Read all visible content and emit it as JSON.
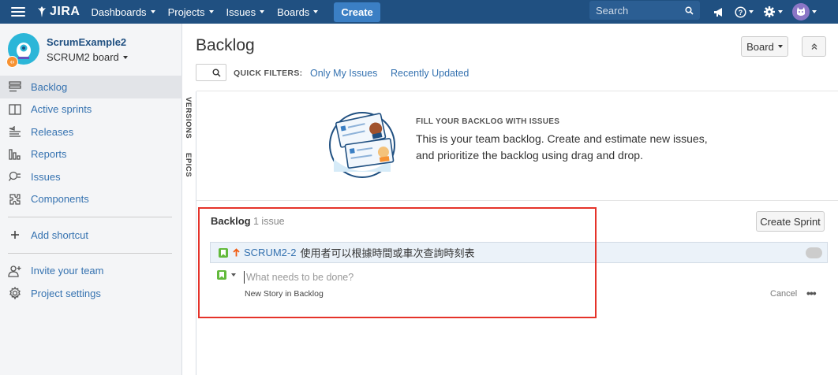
{
  "topnav": {
    "logo_text": "JIRA",
    "menus": [
      "Dashboards",
      "Projects",
      "Issues",
      "Boards"
    ],
    "create_label": "Create",
    "search_placeholder": "Search",
    "bg_color": "#205081"
  },
  "sidebar": {
    "project_name": "ScrumExample2",
    "board_name": "SCRUM2 board",
    "items": [
      {
        "label": "Backlog",
        "icon": "backlog-icon"
      },
      {
        "label": "Active sprints",
        "icon": "active-sprints-icon"
      },
      {
        "label": "Releases",
        "icon": "releases-icon"
      },
      {
        "label": "Reports",
        "icon": "reports-icon"
      },
      {
        "label": "Issues",
        "icon": "issues-icon"
      },
      {
        "label": "Components",
        "icon": "components-icon"
      }
    ],
    "add_shortcut": "Add shortcut",
    "invite_team": "Invite your team",
    "project_settings": "Project settings"
  },
  "strip": {
    "versions": "VERSIONS",
    "epics": "EPICS"
  },
  "header": {
    "title": "Backlog",
    "board_button": "Board",
    "quick_filters_label": "QUICK FILTERS:",
    "filters": [
      "Only My Issues",
      "Recently Updated"
    ]
  },
  "empty_state": {
    "heading": "FILL YOUR BACKLOG WITH ISSUES",
    "body": "This is your team backlog. Create and estimate new issues, and prioritize the backlog using drag and drop."
  },
  "backlog": {
    "title": "Backlog",
    "count": "1 issue",
    "create_sprint": "Create Sprint",
    "issues": [
      {
        "key": "SCRUM2-2",
        "summary": "使用者可以根據時間或車次查詢時刻表",
        "type_icon": "story-icon",
        "priority_icon": "priority-high-arrow-icon"
      }
    ],
    "new_issue_placeholder": "What needs to be done?",
    "new_issue_hint": "New Story in Backlog",
    "cancel": "Cancel",
    "more": "•••",
    "highlight_color": "#e5332a"
  }
}
